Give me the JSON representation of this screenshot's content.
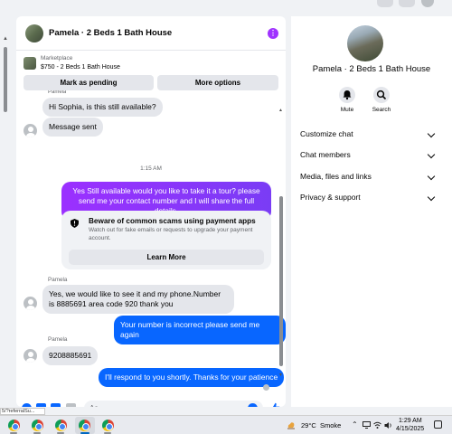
{
  "chat": {
    "title": "Pamela · 2 Beds 1 Bath House",
    "marketplace_label": "Marketplace",
    "listing": "$750 - 2 Beds 1 Bath House",
    "mark_pending": "Mark as pending",
    "more_options": "More options"
  },
  "messages": {
    "sender_cut": "Pamela",
    "m1": "Hi Sophia, is this still available?",
    "m2": "Message sent",
    "timestamp": "1:15 AM",
    "m3": "Yes Still available would you like to take it a tour? please send me your contact number and I will share the full details.",
    "scam_title": "Beware of common scams using payment apps",
    "scam_desc": "Watch out for fake emails or requests to upgrade your payment account.",
    "learn_more": "Learn More",
    "sender1": "Pamela",
    "m4": "Yes, we would like to see it and my phone.Number is 8885691 area code 920 thank you",
    "m5": "Your number is incorrect please send me again",
    "sender2": "Pamela",
    "m6": "9208885691",
    "m7": "I'll respond to you shortly. Thanks for your patience"
  },
  "composer": {
    "placeholder": "Aa"
  },
  "right_panel": {
    "title": "Pamela · 2 Beds 1 Bath House",
    "mute": "Mute",
    "search": "Search",
    "rows": [
      "Customize chat",
      "Chat members",
      "Media, files and links",
      "Privacy & support"
    ]
  },
  "status_url": "5/?referralSu...",
  "taskbar": {
    "temperature": "29°C",
    "condition": "Smoke",
    "time": "1:29 AM",
    "date": "4/15/2025"
  },
  "colors": {
    "accent_blue": "#0866ff",
    "purple": "#8a2be2",
    "bubble_gray": "#e4e6eb"
  }
}
